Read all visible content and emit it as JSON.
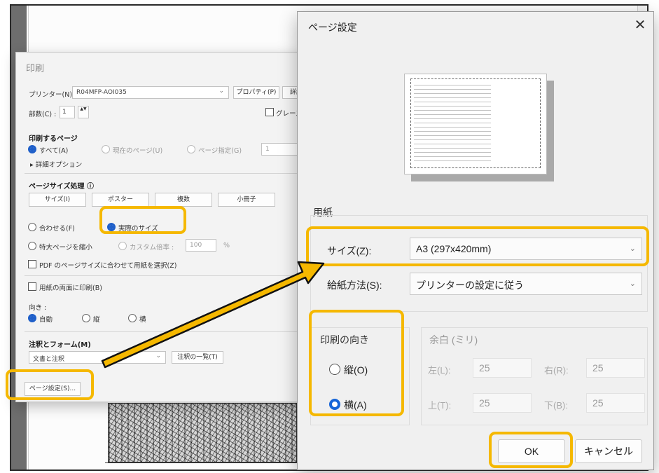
{
  "print_dialog": {
    "title": "印刷",
    "printer_label": "プリンター(N) :",
    "printer_value": "R04MFP-AOI035",
    "properties_button": "プロパティ(P)",
    "advanced_button": "詳細",
    "copies_label": "部数(C) :",
    "copies_value": "1",
    "grayscale_label": "グレース",
    "pages_heading": "印刷するページ",
    "pages_options": [
      "すべて(A)",
      "現在のページ(U)",
      "ページ指定(G)"
    ],
    "pages_range_value": "1",
    "more_options": "▸ 詳細オプション",
    "sizing_heading": "ページサイズ処理 ⓘ",
    "sizing_buttons": [
      "サイズ(I)",
      "ポスター",
      "複数",
      "小冊子"
    ],
    "fit_label": "合わせる(F)",
    "actual_size_label": "実際のサイズ",
    "shrink_label": "特大ページを縮小",
    "custom_scale_label": "カスタム倍率 :",
    "custom_scale_value": "100",
    "percent_sign": "%",
    "pdf_paper_label": "PDF のページサイズに合わせて用紙を選択(Z)",
    "duplex_label": "用紙の両面に印刷(B)",
    "orientation_label": "向き :",
    "orientation_options": [
      "自動",
      "縦",
      "横"
    ],
    "comments_heading": "注釈とフォーム(M)",
    "comments_value": "文書と注釈",
    "comments_summary_button": "注釈の一覧(T)",
    "page_setup_button": "ページ設定(S)..."
  },
  "page_setup": {
    "title": "ページ設定",
    "close_glyph": "✕",
    "paper_group": "用紙",
    "size_label": "サイズ(Z):",
    "size_value": "A3 (297x420mm)",
    "source_label": "給紙方法(S):",
    "source_value": "プリンターの設定に従う",
    "orientation_group": "印刷の向き",
    "portrait_label": "縦(O)",
    "landscape_label": "横(A)",
    "margins_group": "余白 (ミリ)",
    "left_label": "左(L):",
    "left_value": "25",
    "right_label": "右(R):",
    "right_value": "25",
    "top_label": "上(T):",
    "top_value": "25",
    "bottom_label": "下(B):",
    "bottom_value": "25",
    "ok_button": "OK",
    "cancel_button": "キャンセル"
  },
  "icons": {
    "chevron": "⌄",
    "spinner": "▲▼"
  },
  "colors": {
    "highlight": "#f5b800",
    "radio_selected": "#1f5fc9",
    "arrow_fill": "#f5b800"
  }
}
